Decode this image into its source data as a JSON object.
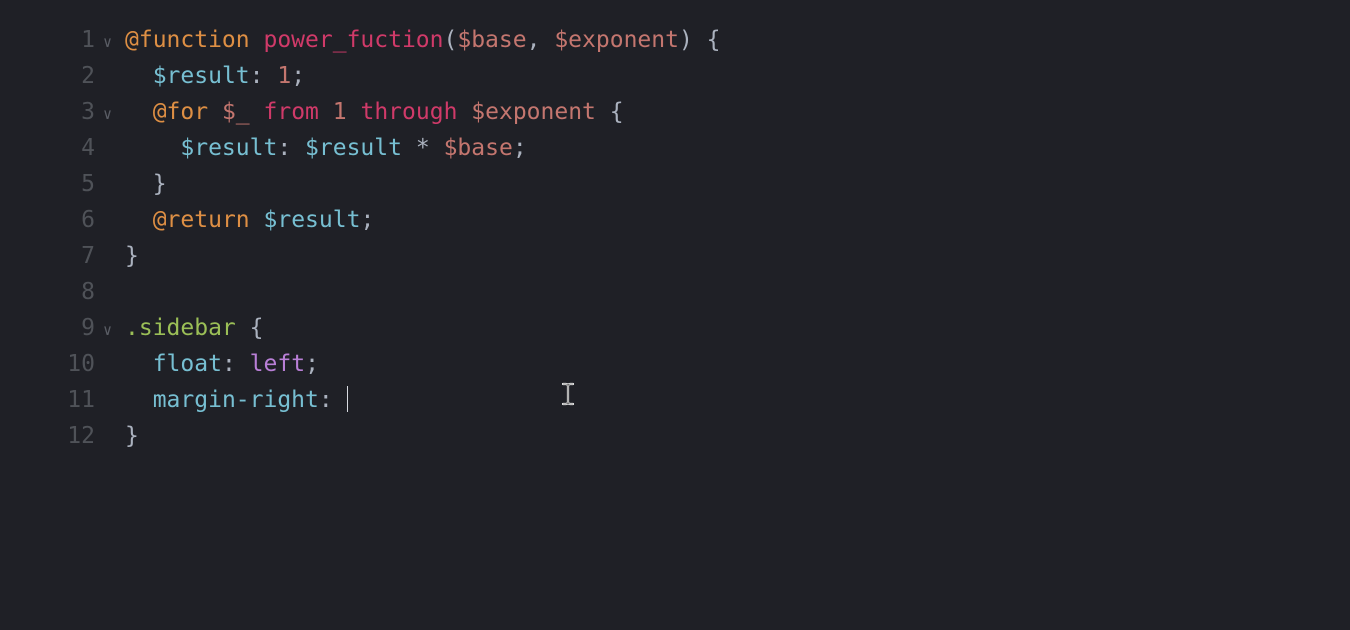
{
  "gutter": {
    "l1": "1",
    "l2": "2",
    "l3": "3",
    "l4": "4",
    "l5": "5",
    "l6": "6",
    "l7": "7",
    "l8": "8",
    "l9": "9",
    "l10": "10",
    "l11": "11",
    "l12": "12"
  },
  "fold": {
    "open": "∨"
  },
  "tok": {
    "at_function": "@function",
    "fn_name": "power_fuction",
    "lp": "(",
    "rp": ")",
    "base": "$base",
    "exponent": "$exponent",
    "comma": ",",
    "sp": " ",
    "lb": "{",
    "rb": "}",
    "result": "$result",
    "colon": ":",
    "one": "1",
    "semi": ";",
    "at_for": "@for",
    "underscore": "$_",
    "from": "from",
    "through": "through",
    "star": "*",
    "at_return": "@return",
    "sidebar": ".sidebar",
    "float": "float",
    "left": "left",
    "margin_right": "margin-right",
    "indent1": "  ",
    "indent2": "    "
  }
}
